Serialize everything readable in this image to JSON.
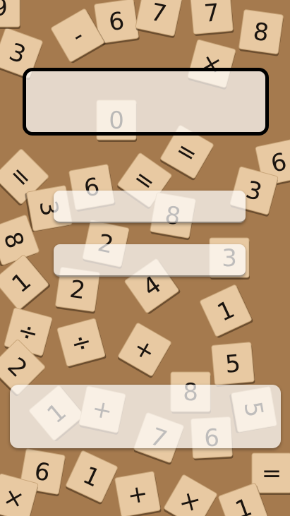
{
  "background": {
    "image": "wooden-number-tiles",
    "colors": {
      "wood": "#e8c9a2",
      "table": "#a57a4e",
      "ink": "#1a140f"
    },
    "tiles": [
      [
        "6",
        165,
        30,
        -8
      ],
      [
        "7",
        225,
        18,
        12
      ],
      [
        "7",
        300,
        18,
        -5
      ],
      [
        "8",
        370,
        45,
        8
      ],
      [
        "3",
        25,
        75,
        20
      ],
      [
        "-",
        110,
        50,
        -30
      ],
      [
        "×",
        300,
        90,
        15
      ],
      [
        "0",
        165,
        170,
        0
      ],
      [
        "=",
        265,
        215,
        30
      ],
      [
        "6",
        395,
        230,
        -12
      ],
      [
        "=",
        30,
        250,
        45
      ],
      [
        "6",
        130,
        265,
        -10
      ],
      [
        "=",
        205,
        255,
        35
      ],
      [
        "3",
        360,
        270,
        15
      ],
      [
        "3",
        70,
        295,
        80
      ],
      [
        "8",
        245,
        305,
        10
      ],
      [
        "8",
        20,
        340,
        70
      ],
      [
        "2",
        150,
        345,
        12
      ],
      [
        "3",
        325,
        365,
        0
      ],
      [
        "1",
        30,
        400,
        -40
      ],
      [
        "2",
        110,
        410,
        8
      ],
      [
        "4",
        215,
        405,
        -35
      ],
      [
        "1",
        320,
        440,
        -25
      ],
      [
        "÷",
        40,
        470,
        15
      ],
      [
        "÷",
        115,
        485,
        -15
      ],
      [
        "+",
        205,
        495,
        30
      ],
      [
        "5",
        330,
        515,
        -5
      ],
      [
        "2",
        25,
        520,
        45
      ],
      [
        "8",
        270,
        555,
        0
      ],
      [
        "5",
        360,
        580,
        80
      ],
      [
        "1",
        80,
        585,
        -40
      ],
      [
        "+",
        145,
        580,
        12
      ],
      [
        "7",
        225,
        620,
        20
      ],
      [
        "6",
        300,
        620,
        -3
      ],
      [
        "6",
        60,
        668,
        10
      ],
      [
        "1",
        130,
        675,
        25
      ],
      [
        "+",
        195,
        700,
        -10
      ],
      [
        "×",
        270,
        710,
        30
      ],
      [
        "=",
        385,
        670,
        0
      ],
      [
        "1",
        345,
        720,
        -20
      ],
      [
        "×",
        20,
        705,
        15
      ],
      [
        "9",
        0,
        10,
        0
      ]
    ]
  },
  "display": {
    "text": ""
  },
  "inputs": [
    {
      "value": ""
    },
    {
      "value": ""
    }
  ],
  "result_panel": {
    "text": ""
  }
}
